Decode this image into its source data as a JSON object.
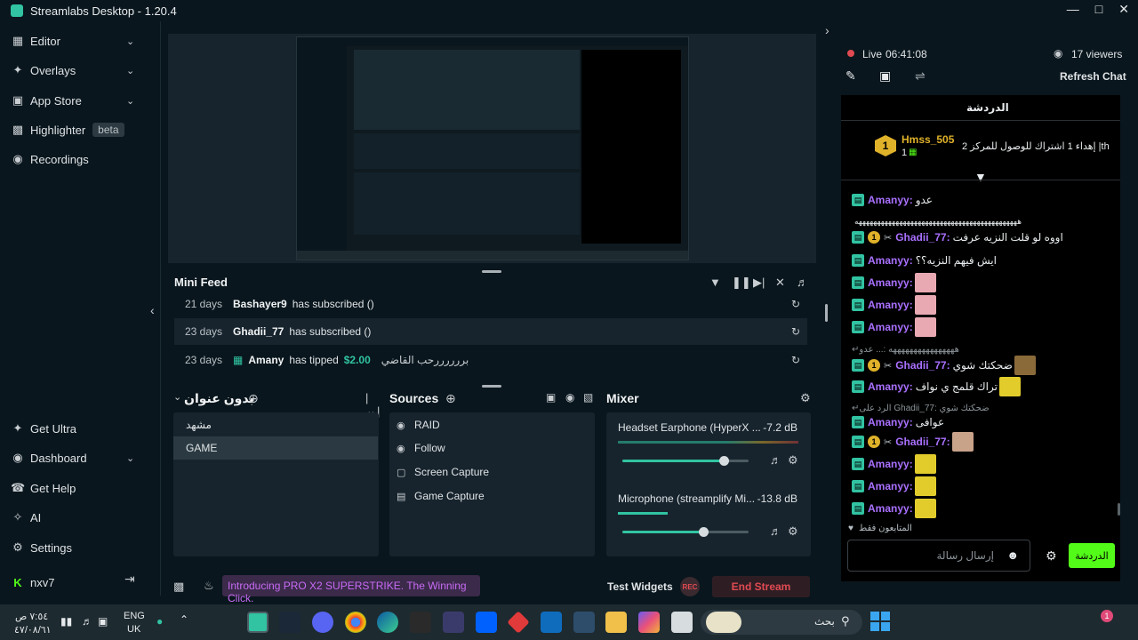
{
  "app": {
    "title": "Streamlabs Desktop - 1.20.4"
  },
  "leftnav": {
    "top": [
      {
        "label": "Editor",
        "icon": "editor-icon",
        "chevron": true
      },
      {
        "label": "Overlays",
        "icon": "overlays-icon",
        "chevron": true
      },
      {
        "label": "App Store",
        "icon": "app-store-icon",
        "chevron": true
      },
      {
        "label": "Highlighter",
        "icon": "highlighter-icon",
        "chevron": false,
        "badge": "beta"
      },
      {
        "label": "Recordings",
        "icon": "recordings-icon",
        "chevron": false
      }
    ],
    "bottom": [
      {
        "label": "Get Ultra",
        "icon": "ultra-icon"
      },
      {
        "label": "Dashboard",
        "icon": "dashboard-icon"
      },
      {
        "label": "Get Help",
        "icon": "help-icon"
      },
      {
        "label": "AI",
        "icon": "ai-icon"
      },
      {
        "label": "Settings",
        "icon": "settings-icon"
      },
      {
        "label": "nxv7",
        "icon": "kick-icon"
      }
    ]
  },
  "minifeed": {
    "title": "Mini Feed",
    "rows": [
      {
        "days": "21 days",
        "name": "Bashayer9",
        "action": "has subscribed ()",
        "amount": "",
        "message": ""
      },
      {
        "days": "23 days",
        "name": "Ghadii_77",
        "action": "has subscribed ()",
        "amount": "",
        "message": ""
      },
      {
        "days": "23 days",
        "name": "Amany",
        "action": "has tipped",
        "amount": "$2.00",
        "message": "بررررررحب القاضي"
      }
    ]
  },
  "scenes": {
    "title": "بدون عنوان",
    "items": [
      "مشهد",
      "GAME"
    ],
    "selected": "GAME"
  },
  "sources": {
    "title": "Sources",
    "items": [
      {
        "label": "RAID",
        "icon": "globe-icon"
      },
      {
        "label": "Follow",
        "icon": "globe-icon"
      },
      {
        "label": "Screen Capture",
        "icon": "monitor-icon"
      },
      {
        "label": "Game Capture",
        "icon": "gamepad-icon"
      }
    ]
  },
  "mixer": {
    "title": "Mixer",
    "channels": [
      {
        "name": "Headset Earphone (HyperX ...",
        "db": "-7.2 dB",
        "volume": 0.8
      },
      {
        "name": "Microphone (streamplify Mi...",
        "db": "-13.8 dB",
        "volume": 0.64
      }
    ]
  },
  "footer": {
    "promo": "Introducing PRO X2 SUPERSTRIKE. The Winning Click.",
    "test_widgets": "Test Widgets",
    "rec": "REC",
    "end_stream": "End Stream"
  },
  "stream": {
    "live_label": "Live",
    "live_time": "06:41:08",
    "viewers": "17 viewers",
    "refresh_chat": "Refresh Chat"
  },
  "chat": {
    "header": "الدردشة",
    "pinned": {
      "user": "Hmss_505",
      "rank": "1",
      "count": "1",
      "text": "إهداء 1 اشتراك للوصول للمركز 2 |th"
    },
    "messages": [
      {
        "user": "Amanyy",
        "text": "عدو",
        "gold": false,
        "tk": false
      },
      {
        "user": "",
        "text": "ههههههههههههههههههههههههههههههههههههههههههههه",
        "gold": false,
        "tk": false
      },
      {
        "user": "Ghadii_77",
        "text": "اووه لو قلت النزيه عرفت",
        "gold": true,
        "tk": true
      },
      {
        "user": "Amanyy",
        "text": "ايش فيهم النزيه؟؟",
        "gold": false,
        "tk": false
      },
      {
        "user": "Amanyy",
        "text": "",
        "gold": false,
        "tk": false,
        "emote": "pink"
      },
      {
        "user": "Amanyy",
        "text": "",
        "gold": false,
        "tk": false,
        "emote": "pink"
      },
      {
        "user": "Amanyy",
        "text": "",
        "gold": false,
        "tk": false,
        "emote": "pink"
      },
      {
        "user": "",
        "text": "ههههههههههههههههه :... عدو",
        "gold": false,
        "tk": false,
        "reply": true
      },
      {
        "user": "Ghadii_77",
        "text": "ضحكتك شوي",
        "gold": true,
        "tk": true,
        "emote": "brown"
      },
      {
        "user": "Amanyy",
        "text": "تراك قلمج ي نواف",
        "gold": false,
        "tk": false,
        "emote": "yellow"
      },
      {
        "user": "",
        "text": "الرد على Ghadii_77: ضحكتك شوي",
        "gold": false,
        "tk": false,
        "reply": true
      },
      {
        "user": "Amanyy",
        "text": "عوافى",
        "gold": false,
        "tk": false
      },
      {
        "user": "Ghadii_77",
        "text": "",
        "gold": true,
        "tk": true,
        "emote": "face"
      },
      {
        "user": "Amanyy",
        "text": "",
        "gold": false,
        "tk": false,
        "emote": "yellow"
      },
      {
        "user": "Amanyy",
        "text": "",
        "gold": false,
        "tk": false,
        "emote": "yellow"
      },
      {
        "user": "Amanyy",
        "text": "",
        "gold": false,
        "tk": false,
        "emote": "yellow"
      }
    ],
    "followers_only": "المتابعون فقط",
    "input_placeholder": "إرسال رسالة",
    "send_label": "الدردشة"
  },
  "taskbar": {
    "time": "٧:٥٤ ص",
    "date": "٤٧/٠٨/٦١",
    "lang_top": "ENG",
    "lang_bottom": "UK",
    "search_placeholder": "بحث",
    "notif_count": "1"
  },
  "colors": {
    "accent": "#31c3a2",
    "bg": "#09161d",
    "panel": "#17242d",
    "chat_user": "#a970ff",
    "end_stream": "#e04a52"
  }
}
